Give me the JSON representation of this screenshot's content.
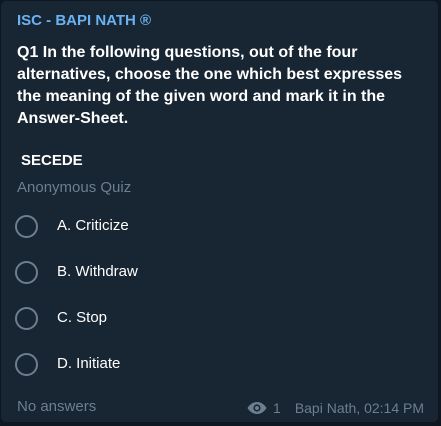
{
  "message": {
    "channel_name": "ISC - BAPI NATH ®",
    "question": "Q1 In the following questions, out of the four alternatives, choose the one which best expresses the meaning of the given word and mark it in the Answer-Sheet.",
    "word": "SECEDE",
    "poll_type": "Anonymous Quiz",
    "options": [
      {
        "label": "A. Criticize"
      },
      {
        "label": "B. Withdraw"
      },
      {
        "label": "C. Stop"
      },
      {
        "label": "D. Initiate"
      }
    ],
    "footer": {
      "answers_status": "No answers",
      "views_icon": "eye-icon",
      "views": "1",
      "author_time": "Bapi Nath, 02:14 PM"
    }
  },
  "colors": {
    "background": "#0e1621",
    "bubble": "#182533",
    "channel_name": "#6ab3f3",
    "muted": "#6d7f8f",
    "text": "#ffffff"
  }
}
